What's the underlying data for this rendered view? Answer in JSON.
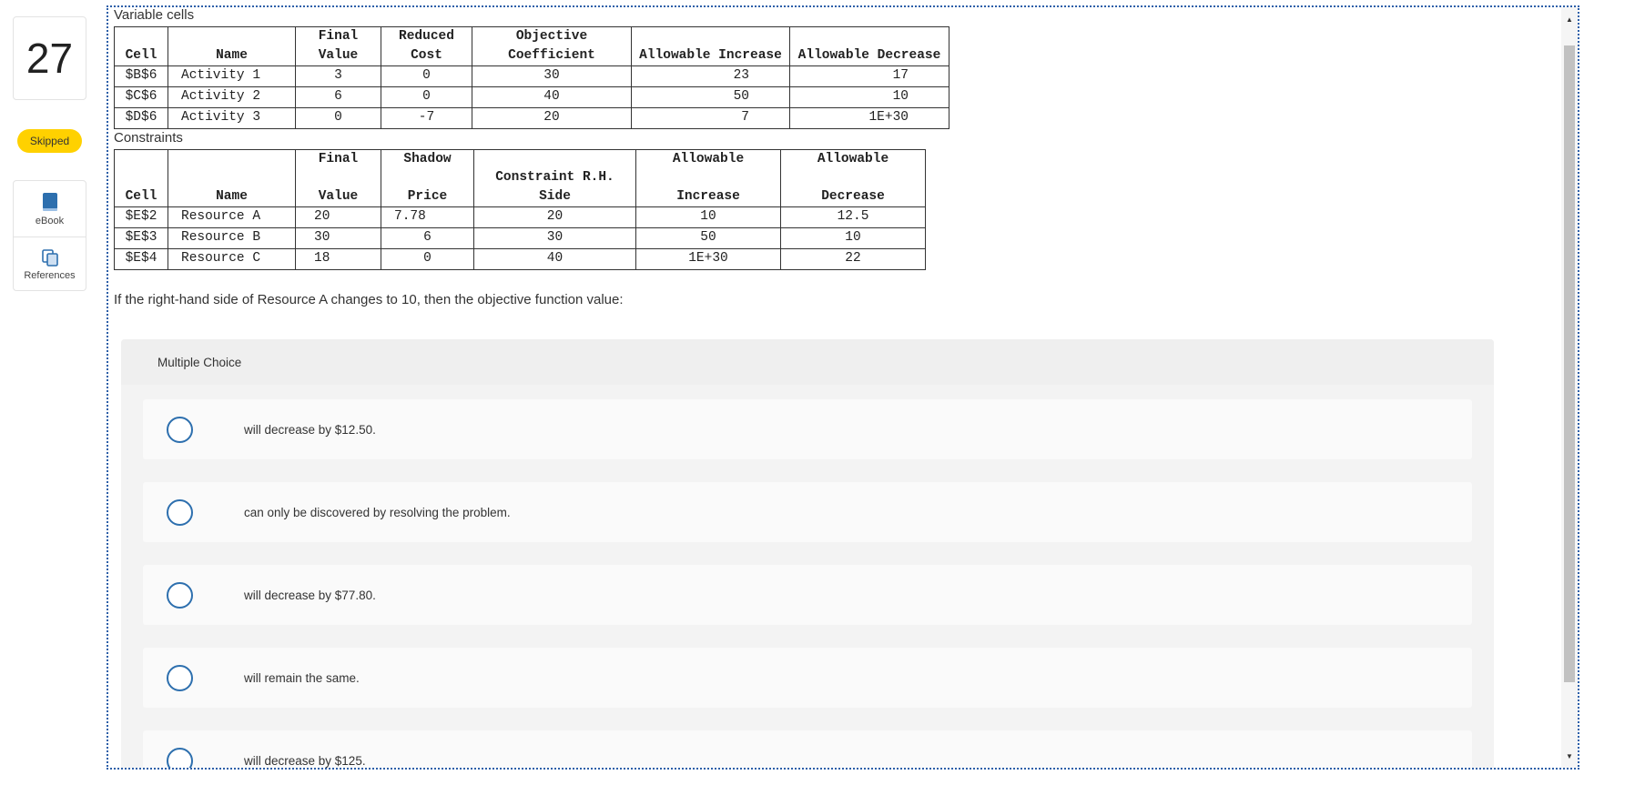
{
  "question": {
    "number": "27",
    "status": "Skipped",
    "prompt": "If the right-hand side of Resource A changes to 10, then the objective function value:"
  },
  "tools": [
    {
      "label": "eBook",
      "icon": "book-icon"
    },
    {
      "label": "References",
      "icon": "copy-icon"
    }
  ],
  "variable_cells": {
    "title": "Variable cells",
    "headers_top": [
      "",
      "",
      "Final",
      "Reduced",
      "Objective",
      "",
      ""
    ],
    "headers_bottom": [
      "Cell",
      "Name",
      "Value",
      "Cost",
      "Coefficient",
      "Allowable Increase",
      "Allowable Decrease"
    ],
    "rows": [
      [
        "$B$6",
        "Activity 1",
        "3",
        "0",
        "30",
        "23",
        "17"
      ],
      [
        "$C$6",
        "Activity 2",
        "6",
        "0",
        "40",
        "50",
        "10"
      ],
      [
        "$D$6",
        "Activity 3",
        "0",
        "-7",
        "20",
        "7",
        "1E+30"
      ]
    ]
  },
  "constraints": {
    "title": "Constraints",
    "headers_top": [
      "",
      "",
      "Final",
      "Shadow",
      "",
      "Allowable",
      "Allowable"
    ],
    "headers_bottom": [
      "Cell",
      "Name",
      "Value",
      "Price",
      "Constraint R.H. Side",
      "Increase",
      "Decrease"
    ],
    "rows": [
      [
        "$E$2",
        "Resource A",
        "20",
        "7.78",
        "20",
        "10",
        "12.5"
      ],
      [
        "$E$3",
        "Resource B",
        "30",
        "6",
        "30",
        "50",
        "10"
      ],
      [
        "$E$4",
        "Resource C",
        "18",
        "0",
        "40",
        "1E+30",
        "22"
      ]
    ]
  },
  "multiple_choice": {
    "header": "Multiple Choice",
    "options": [
      "will decrease by $12.50.",
      "can only be discovered by resolving the problem.",
      "will decrease by $77.80.",
      "will remain the same.",
      "will decrease by $125."
    ]
  },
  "colors": {
    "badge": "#ffd100",
    "radio": "#2d6fae",
    "frame": "#2c5fa8"
  }
}
